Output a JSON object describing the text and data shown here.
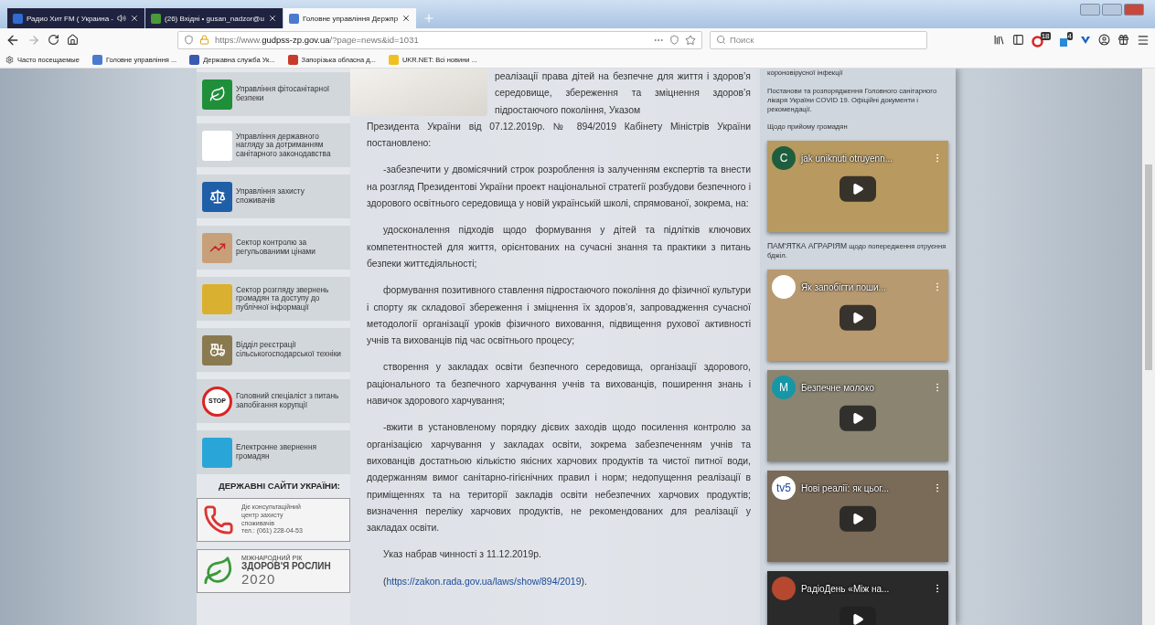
{
  "tabs": [
    {
      "label": "Радио Хит FM ( Украина - ",
      "selected": false,
      "audio": true
    },
    {
      "label": "(26) Вхідні • gusan_nadzor@u",
      "selected": false,
      "audio": false
    },
    {
      "label": "Головне управління Держпр",
      "selected": true,
      "audio": false
    }
  ],
  "address": {
    "prefix": "https://www.",
    "domain": "gudpss-zp.gov.ua",
    "path": "/?page=news&id=1031"
  },
  "search": {
    "placeholder": "Поиск"
  },
  "badges": [
    {
      "text": "18"
    },
    {
      "text": "4"
    }
  ],
  "bookmarks": [
    "Часто посещаемые",
    "Головне управління ...",
    "Державна служба Ук...",
    "Запорізька обласна д...",
    "UKR.NET: Всі новини ..."
  ],
  "left_menu": [
    {
      "label": "Управління фітосанітарної безпеки"
    },
    {
      "label": "Управління державного нагляду за дотриманням санітарного законодавства"
    },
    {
      "label": "Управління захисту споживачів"
    },
    {
      "label": "Сектор контролю за регульованими цінами"
    },
    {
      "label": "Сектор розгляду звернень громадян та доступу до публічної інформації"
    },
    {
      "label": "Відділ реєстрації сільськогосподарської техніки"
    },
    {
      "label": "Головний спеціаліст з питань запобігання корупції",
      "icon_text": "STOP"
    },
    {
      "label": "Електронне звернення громадян"
    }
  ],
  "state_sites": {
    "title": "ДЕРЖАВНІ САЙТИ УКРАЇНИ:",
    "consumer_center": [
      "Діє консультаційний",
      "центр захисту",
      "споживачів",
      "тел.: (061) 228-04-53"
    ],
    "plant_health": {
      "small": "МІЖНАРОДНИЙ РІК",
      "big": "ЗДОРОВ'Я РОСЛИН",
      "year": "2020"
    }
  },
  "article": {
    "intro": {
      "beside_photo": "реалізації права дітей на безпечне для життя і здоров’я середовище, збереження та зміцнення здоров’я підростаючого покоління, Указом",
      "continued": "Президента України від 07.12.2019р. № 894/2019 Кабінету Міністрів України постановлено:"
    },
    "paragraphs": [
      "-забезпечити у двомісячний строк розроблення із залученням експертів та внести на розгляд Президентові України проект національної стратегії розбудови безпечного і здорового освітнього середовища у новій українській школі, спрямованої, зокрема, на:",
      "удосконалення підходів щодо формування у дітей та підлітків ключових компетентностей для життя, орієнтованих на сучасні знання та практики з питань безпеки життєдіяльності;",
      "формування позитивного ставлення підростаючого покоління до фізичної культури і спорту як складової збереження і зміцнення їх здоров’я, запровадження сучасної методології організації уроків фізичного виховання, підвищення рухової активності учнів та вихованців під час освітнього процесу;",
      "створення у закладах освіти безпечного середовища, організації здорового, раціонального та безпечного харчування учнів та вихованців, поширення знань і навичок здорового харчування;",
      "-вжити в установленому порядку дієвих заходів щодо посилення контролю за організацією харчування у закладах освіти, зокрема забезпеченням учнів та вихованців достатньою кількістю якісних харчових продуктів та чистої питної води, додержанням вимог санітарно-гігієнічних правил і норм; недопущення реалізації в приміщеннях та на території закладів освіти небезпечних харчових продуктів; визначення переліку харчових продуктів, не рекомендованих для реалізації у закладах освіти.",
      "Указ набрав чинності з 11.12.2019р."
    ],
    "link": {
      "before": "(",
      "url": "https://zakon.rada.gov.ua/laws/show/894/2019",
      "after": ")."
    }
  },
  "right": {
    "top_text": "короновірусної інфекції",
    "decrees": "Постанови та розпорядження Головного санітарного лікаря України COVID 19. Офіційні документи і рекомендації.",
    "reception": "Щодо прийому громадян",
    "memo": {
      "bold": "ПАМ'ЯТКА АГРАРІЯМ",
      "rest": "щодо попередження отруєння бджіл."
    },
    "videos": [
      {
        "title": "jak uniknuti otruyenn...",
        "avatar": "C",
        "color": "#1e5e3e"
      },
      {
        "title": "Як запобігти поши...",
        "color": "#ffffff"
      },
      {
        "title": "Безпечне молоко",
        "avatar": "M",
        "color": "#1597a6"
      },
      {
        "title": "Нові реалії: як цьог...",
        "avatar": "tv5",
        "color": "#ffffff"
      },
      {
        "title": "РадіоДень «Між на...",
        "color": "#b5482f"
      }
    ]
  }
}
